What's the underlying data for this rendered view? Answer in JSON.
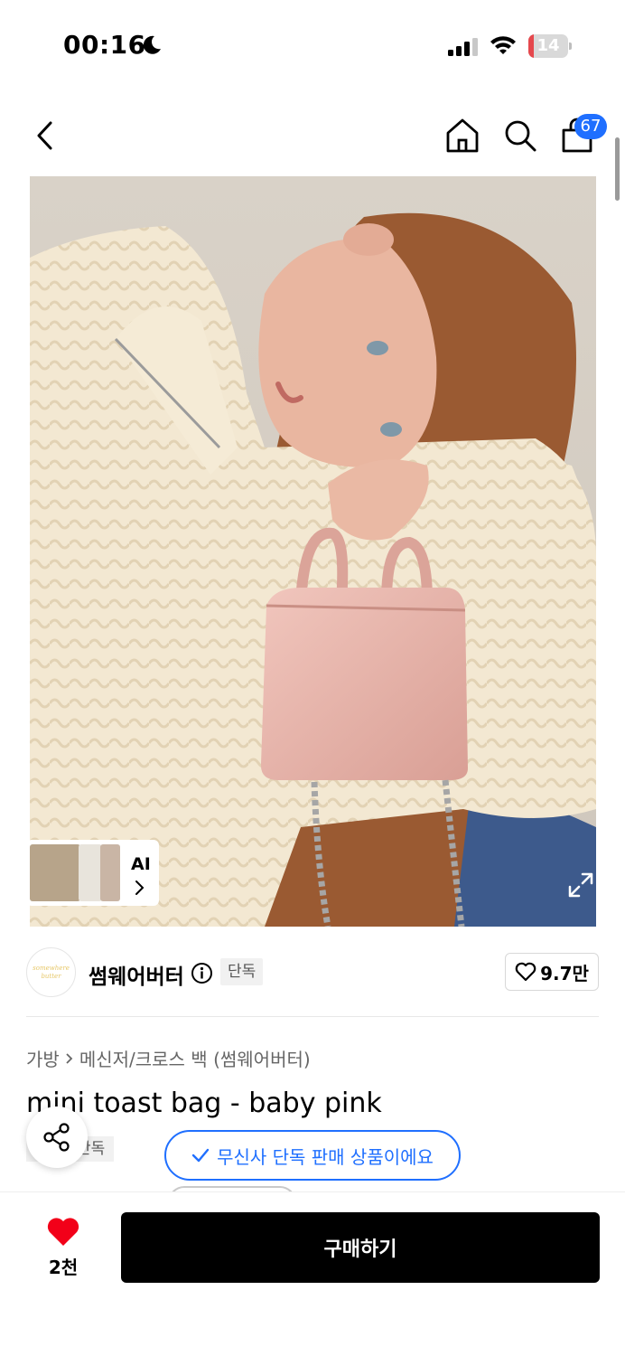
{
  "status_bar": {
    "time": "00:16",
    "battery_level": "14",
    "battery_color": "#e5484d"
  },
  "nav": {
    "cart_count": "67",
    "icons": [
      "back-icon",
      "home-icon",
      "search-icon",
      "cart-icon"
    ]
  },
  "gallery": {
    "ai_label": "AI"
  },
  "brand": {
    "name": "썸웨어버터",
    "exclusive_label": "단독",
    "like_count": "9.7만",
    "logo_text": "somewhere butter"
  },
  "product": {
    "breadcrumb": [
      "가방",
      "메신저/크로스 백 (썸웨어버터)"
    ],
    "title": "mini toast bag - baby pink",
    "exclusive_badge": "단독",
    "tooltip": "무신사 단독 판매 상품이에요"
  },
  "bottom_bar": {
    "like_count": "2천",
    "buy_label": "구매하기"
  },
  "colors": {
    "accent_blue": "#1f6fff",
    "heart_red": "#f20019",
    "buy_button": "#000000"
  }
}
